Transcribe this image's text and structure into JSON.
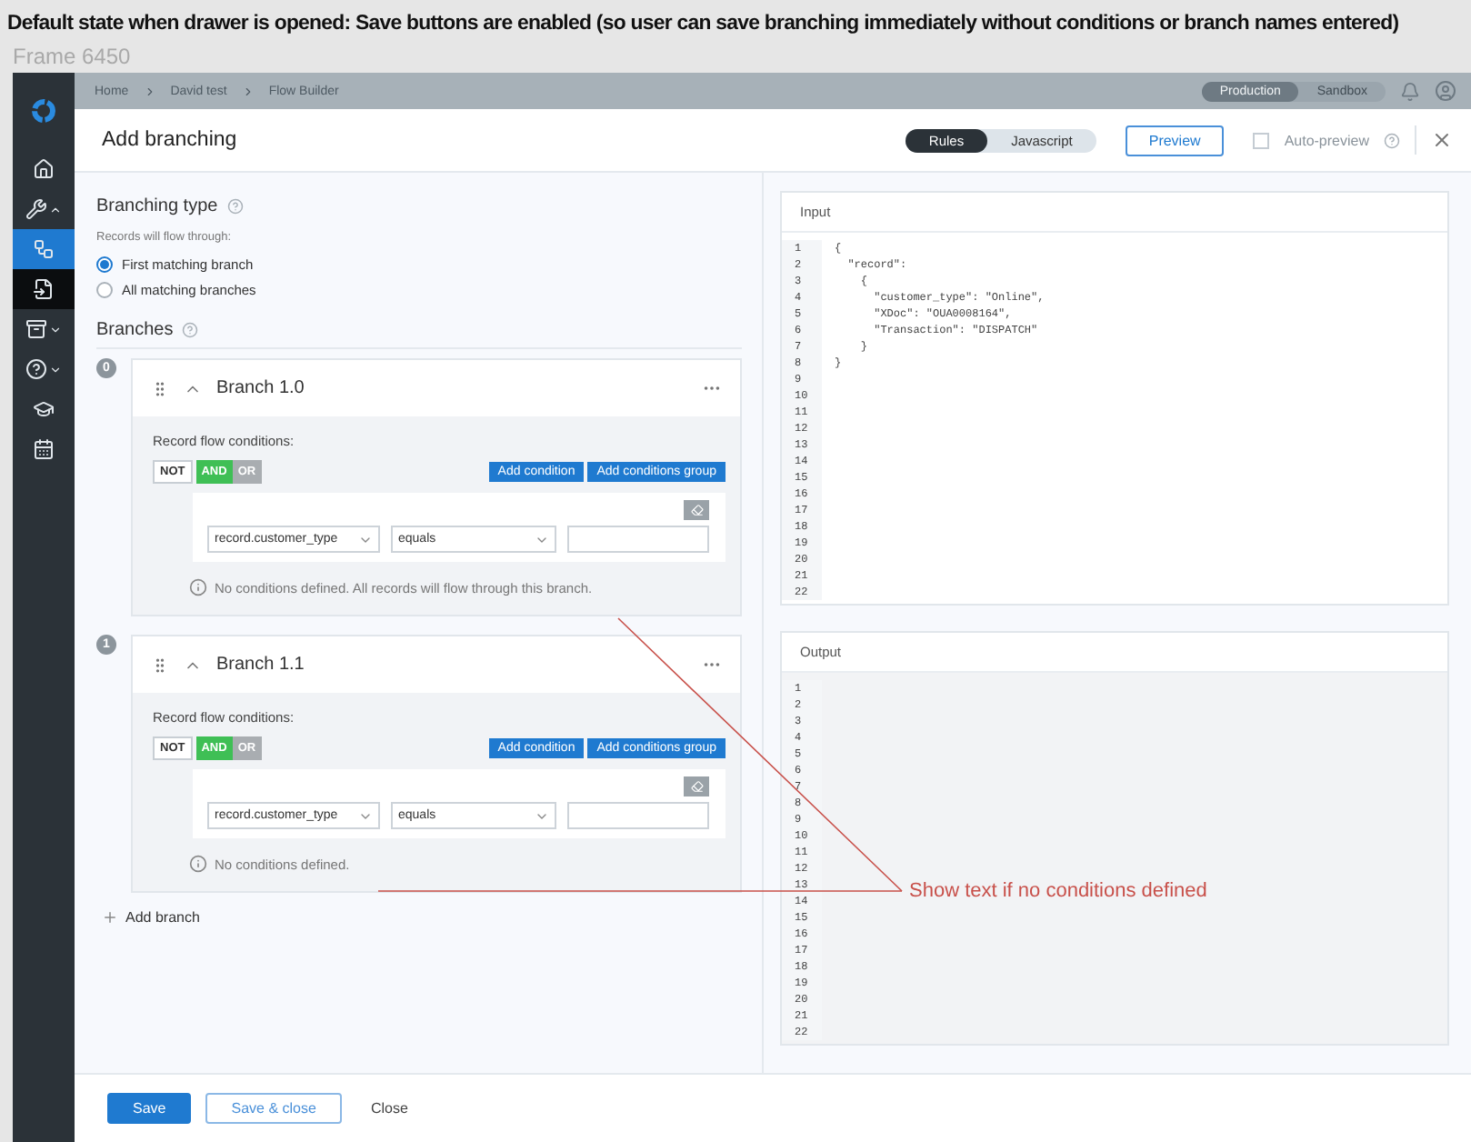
{
  "caption": "Default state when drawer is opened: Save buttons are enabled (so user can save branching immediately without conditions or branch names entered)",
  "frame_label": "Frame 6450",
  "breadcrumb": [
    "Home",
    "David test",
    "Flow Builder"
  ],
  "environments": [
    {
      "label": "Production",
      "selected": true
    },
    {
      "label": "Sandbox",
      "selected": false
    }
  ],
  "sidebar": {
    "items": [
      {
        "kind": "link",
        "selected": false,
        "hovered": false
      },
      {
        "kind": "group",
        "expanded": true,
        "selected": false,
        "hovered": false
      },
      {
        "kind": "link",
        "selected": true,
        "hovered": false
      },
      {
        "kind": "link",
        "selected": false,
        "hovered": true
      },
      {
        "kind": "group",
        "expanded": false,
        "selected": false,
        "hovered": false
      },
      {
        "kind": "group",
        "expanded": false,
        "selected": false,
        "hovered": false
      },
      {
        "kind": "link",
        "selected": false,
        "hovered": false
      },
      {
        "kind": "link",
        "selected": false,
        "hovered": false
      }
    ]
  },
  "drawer": {
    "title": "Add branching",
    "modes": [
      {
        "label": "Rules",
        "selected": true
      },
      {
        "label": "Javascript",
        "selected": false
      }
    ],
    "preview_button": "Preview",
    "auto_preview": {
      "label": "Auto-preview",
      "checked": false
    },
    "branching_type": {
      "title": "Branching type",
      "hint": "Records will flow through:",
      "options": [
        {
          "label": "First matching branch",
          "selected": true
        },
        {
          "label": "All matching branches",
          "selected": false
        }
      ]
    },
    "branches_title": "Branches",
    "branches": [
      {
        "index": "0",
        "name": "Branch 1.0",
        "expanded": true,
        "conditions_label": "Record flow conditions:",
        "not": {
          "label": "NOT",
          "on": false
        },
        "operators": [
          {
            "label": "AND",
            "selected": true
          },
          {
            "label": "OR",
            "selected": false
          }
        ],
        "add_condition": "Add condition",
        "add_group": "Add conditions group",
        "field": "record.customer_type",
        "comparator": "equals",
        "info": "No conditions defined. All records will flow through this branch."
      },
      {
        "index": "1",
        "name": "Branch 1.1",
        "expanded": true,
        "conditions_label": "Record flow conditions:",
        "not": {
          "label": "NOT",
          "on": false
        },
        "operators": [
          {
            "label": "AND",
            "selected": true
          },
          {
            "label": "OR",
            "selected": false
          }
        ],
        "add_condition": "Add condition",
        "add_group": "Add conditions group",
        "field": "record.customer_type",
        "comparator": "equals",
        "info": "No conditions defined."
      }
    ],
    "add_branch": "Add branch",
    "input": {
      "title": "Input",
      "lines": [
        "{",
        "  \"record\":",
        "    {",
        "      \"customer_type\": \"Online\",",
        "      \"XDoc\": \"OUA0008164\",",
        "      \"Transaction\": \"DISPATCH\"",
        "    }",
        "}"
      ],
      "line_numbers": [
        "1",
        "2",
        "3",
        "4",
        "5",
        "6",
        "7",
        "8",
        "9",
        "10",
        "11",
        "12",
        "13",
        "14",
        "15",
        "16",
        "17",
        "18",
        "19",
        "20",
        "21",
        "22"
      ]
    },
    "output": {
      "title": "Output",
      "line_numbers": [
        "1",
        "2",
        "3",
        "4",
        "5",
        "6",
        "7",
        "8",
        "9",
        "10",
        "11",
        "12",
        "13",
        "14",
        "15",
        "16",
        "17",
        "18",
        "19",
        "20",
        "21",
        "22"
      ]
    },
    "footer": {
      "save": "Save",
      "save_close": "Save & close",
      "close": "Close"
    }
  },
  "annotation": "Show text if no conditions defined"
}
